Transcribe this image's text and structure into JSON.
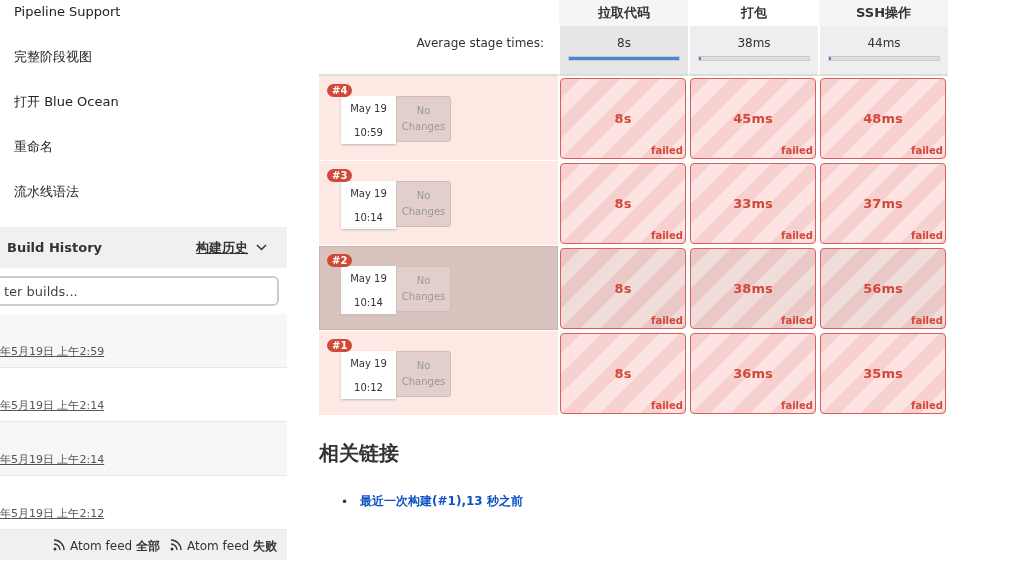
{
  "sidebar": {
    "items": [
      {
        "label": "Pipeline Support"
      },
      {
        "label": "完整阶段视图"
      },
      {
        "label": "打开 Blue Ocean"
      },
      {
        "label": "重命名"
      },
      {
        "label": "流水线语法"
      }
    ]
  },
  "build_history": {
    "title": "Build History",
    "trend_link": "构建历史",
    "filter": {
      "placeholder": "ter builds..."
    },
    "builds": [
      {
        "date": "年5月19日 上午2:59"
      },
      {
        "date": "年5月19日 上午2:14"
      },
      {
        "date": "年5月19日 上午2:14"
      },
      {
        "date": "年5月19日 上午2:12"
      }
    ],
    "feeds": [
      "Atom feed **全部**",
      "Atom feed **失败**"
    ]
  },
  "stage_view": {
    "stages": [
      "拉取代码",
      "打包",
      "SSH操作"
    ],
    "average_label": "Average stage times:",
    "averages": [
      {
        "time": "8s",
        "level": 1
      },
      {
        "time": "38ms",
        "level": 0.01
      },
      {
        "time": "44ms",
        "level": 0.01
      }
    ],
    "runs": [
      {
        "number": "#4",
        "date": "May 19",
        "time": "10:59",
        "changes": "No Changes",
        "selected": false,
        "cells": [
          {
            "duration": "8s",
            "status": "failed"
          },
          {
            "duration": "45ms",
            "status": "failed"
          },
          {
            "duration": "48ms",
            "status": "failed"
          }
        ]
      },
      {
        "number": "#3",
        "date": "May 19",
        "time": "10:14",
        "changes": "No Changes",
        "selected": false,
        "cells": [
          {
            "duration": "8s",
            "status": "failed"
          },
          {
            "duration": "33ms",
            "status": "failed"
          },
          {
            "duration": "37ms",
            "status": "failed"
          }
        ]
      },
      {
        "number": "#2",
        "date": "May 19",
        "time": "10:14",
        "changes": "No Changes",
        "selected": true,
        "cells": [
          {
            "duration": "8s",
            "status": "failed"
          },
          {
            "duration": "38ms",
            "status": "failed"
          },
          {
            "duration": "56ms",
            "status": "failed"
          }
        ]
      },
      {
        "number": "#1",
        "date": "May 19",
        "time": "10:12",
        "changes": "No Changes",
        "selected": false,
        "cells": [
          {
            "duration": "8s",
            "status": "failed"
          },
          {
            "duration": "36ms",
            "status": "failed"
          },
          {
            "duration": "35ms",
            "status": "failed"
          }
        ]
      }
    ]
  },
  "related": {
    "title": "相关链接",
    "bullet": "•",
    "links": [
      "最近一次构建(#1),13 秒之前"
    ]
  }
}
